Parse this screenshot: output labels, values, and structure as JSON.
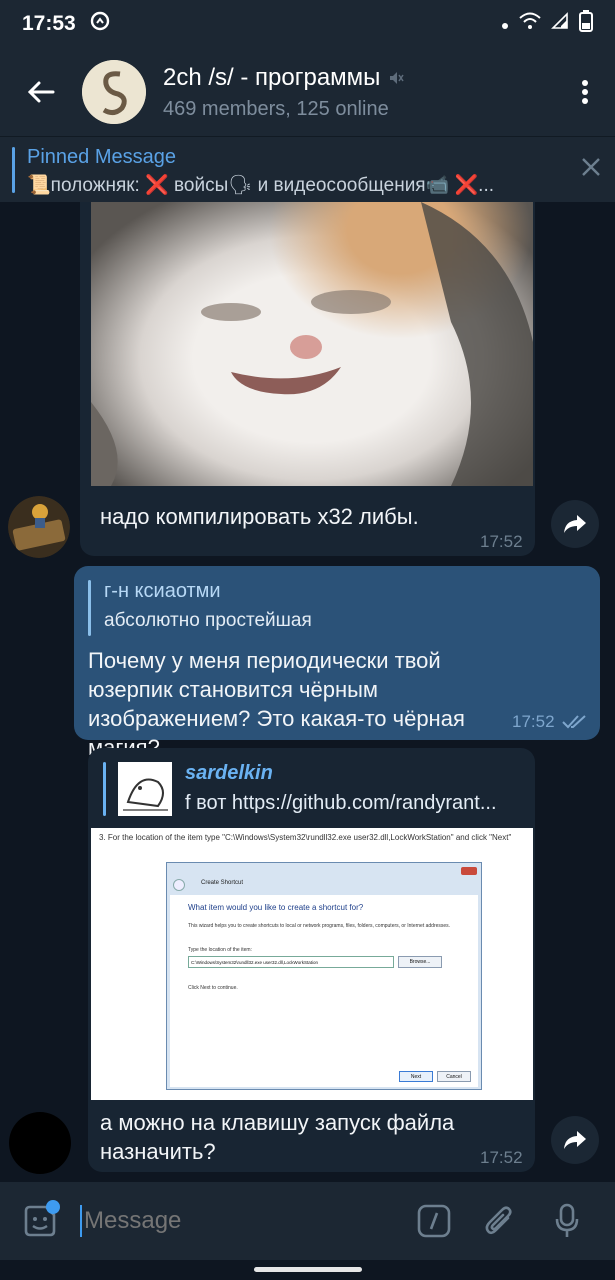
{
  "status_bar": {
    "time": "17:53"
  },
  "header": {
    "title": "2ch /s/ - программы",
    "subtitle": "469 members, 125 online"
  },
  "pinned": {
    "title": "Pinned Message",
    "text": "📜положняк: ❌ войсы🗣 и видеосообщения📹 ❌..."
  },
  "messages": [
    {
      "type": "incoming-photo",
      "text": "надо компилировать x32 либы.",
      "time": "17:52"
    },
    {
      "type": "outgoing-reply",
      "reply_author": "г-н ксиаотми",
      "reply_text": "абсолютно простейшая",
      "text": "Почему у меня периодически твой юзерпик становится чёрным изображением? Это какая-то чёрная магия?",
      "time": "17:52"
    },
    {
      "type": "incoming-reply-photo",
      "reply_author": "sardelkin",
      "reply_text": "f вот https://github.com/randyrant...",
      "screenshot": {
        "step_text": "3. For the location of the item type \"C:\\Windows\\System32\\rundll32.exe user32.dll,LockWorkStation\" and click \"Next\"",
        "dialog_title": "Create Shortcut",
        "heading": "What item would you like to create a shortcut for?",
        "desc": "This wizard helps you to create shortcuts to local or network programs, files, folders, computers, or Internet addresses.",
        "field_label": "Type the location of the item:",
        "field_value": "C:\\Windows\\System32\\rundll32.exe user32.dll,LockWorkStation",
        "browse": "Browse...",
        "hint": "Click Next to continue.",
        "next": "Next",
        "cancel": "Cancel"
      },
      "text": "а можно на клавишу запуск файла назначить?",
      "time": "17:52"
    }
  ],
  "input": {
    "placeholder": "Message"
  },
  "colors": {
    "accent": "#5aa2e6",
    "outgoing": "#2b5278",
    "incoming": "#182533",
    "background": "#0e1621"
  }
}
